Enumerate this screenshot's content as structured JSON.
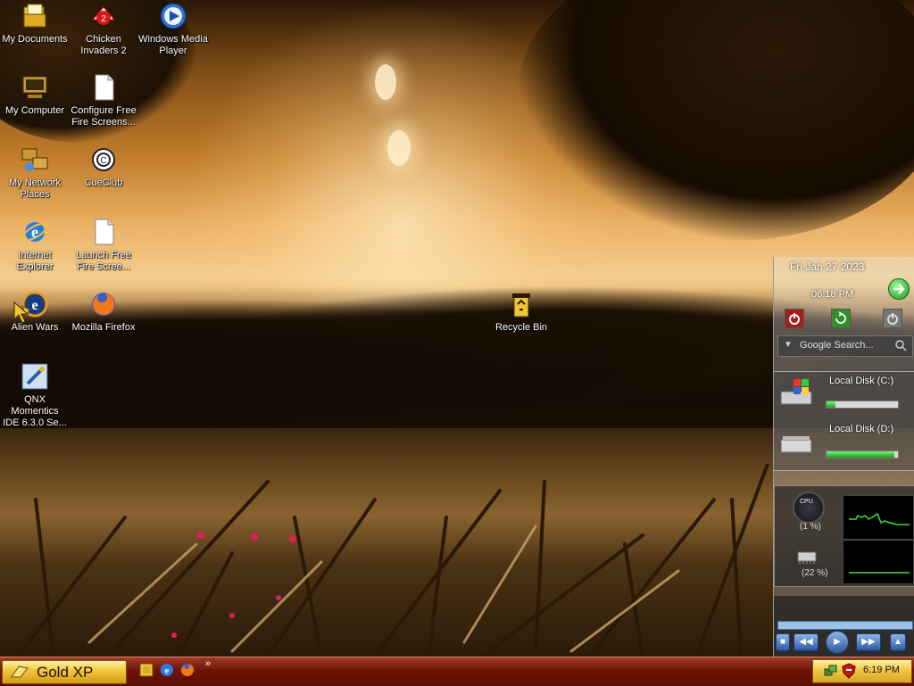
{
  "desktop": {
    "icons": [
      {
        "label": "My Documents"
      },
      {
        "label": "Chicken\nInvaders 2"
      },
      {
        "label": "Windows Media\nPlayer"
      },
      {
        "label": "My Computer"
      },
      {
        "label": "Configure Free\nFire Screens..."
      },
      {
        "label": "My Network\nPlaces"
      },
      {
        "label": "CueClub"
      },
      {
        "label": "Internet\nExplorer"
      },
      {
        "label": "Launch Free\nFire Scree..."
      },
      {
        "label": "Alien Wars"
      },
      {
        "label": "Mozilla Firefox"
      },
      {
        "label": "Recycle Bin"
      },
      {
        "label": "QNX Momentics\nIDE 6.3.0 Se..."
      }
    ]
  },
  "sidebar": {
    "date": "Fri   Jan 27 2023",
    "time": "06:18 PM",
    "search_placeholder": "Google Search...",
    "disks": [
      {
        "label": "Local Disk (C:)",
        "used_fraction": 0.12
      },
      {
        "label": "Local Disk (D:)",
        "used_fraction": 0.95
      }
    ],
    "cpu_label": "(1 %)",
    "ram_label": "(22 %)",
    "cpu_meter_text": "CPU"
  },
  "taskbar": {
    "start_label": "Gold XP",
    "chevron": "»",
    "clock": "6:19 PM"
  },
  "colors": {
    "taskbar": "#6e1406",
    "start_button": "#f3c93f",
    "tray": "#f0c645"
  }
}
